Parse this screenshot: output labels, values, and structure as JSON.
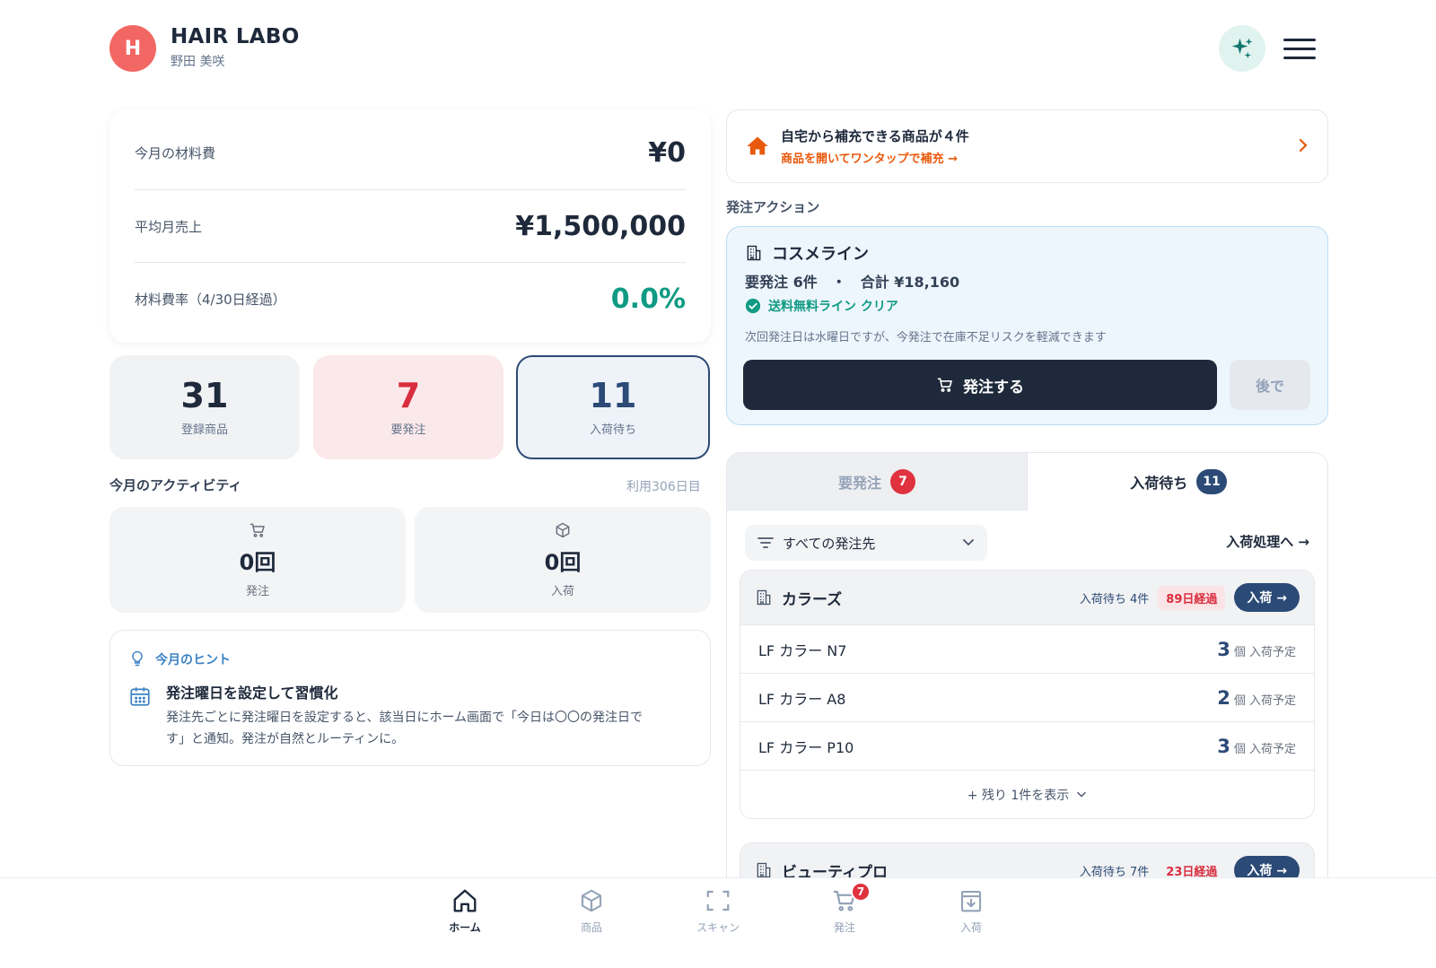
{
  "header": {
    "avatar_initial": "H",
    "brand": "HAIR LABO",
    "user_name": "野田 美咲",
    "ai_icon": "sparkles-icon",
    "menu_icon": "hamburger-menu-icon"
  },
  "metrics": [
    {
      "label": "今月の材料費",
      "value": "¥0"
    },
    {
      "label": "平均月売上",
      "value": "¥1,500,000"
    },
    {
      "label": "材料費率（4/30日経過）",
      "value": "0.0%"
    }
  ],
  "stats": {
    "registered": {
      "value": "31",
      "label": "登録商品"
    },
    "need_order": {
      "value": "7",
      "label": "要発注"
    },
    "awaiting": {
      "value": "11",
      "label": "入荷待ち"
    }
  },
  "activity": {
    "title": "今月のアクティビティ",
    "usage_days": "利用306日目",
    "orders": {
      "value": "0回",
      "label": "発注"
    },
    "arrivals": {
      "value": "0回",
      "label": "入荷"
    }
  },
  "tip": {
    "heading": "今月のヒント",
    "title": "発注曜日を設定して習慣化",
    "body_line1": "発注先ごとに発注曜日を設定すると、該当日にホーム画面で「今日は〇〇の発注日で",
    "body_line2": "す」と通知。発注が自然とルーティンに。"
  },
  "banner": {
    "title": "自宅から補充できる商品が４件",
    "subtitle": "商品を開いてワンタップで補充 →"
  },
  "order_action": {
    "section_label": "発注アクション",
    "supplier": "コスメライン",
    "summary": "要発注 6件　・　合計 ¥18,160",
    "free_shipping": "送料無料ライン クリア",
    "note": "次回発注日は水曜日ですが、今発注で在庫不足リスクを軽減できます",
    "order_button": "発注する",
    "later_button": "後で"
  },
  "tabs": [
    {
      "label": "要発注",
      "count": "7"
    },
    {
      "label": "入荷待ち",
      "count": "11"
    }
  ],
  "filter": {
    "label": "すべての発注先",
    "process_link": "入荷処理へ →"
  },
  "suppliers": [
    {
      "name": "カラーズ",
      "waiting": "入荷待ち 4件",
      "elapsed": "89日経過",
      "button": "入荷 →",
      "items": [
        {
          "name": "LF カラー N7",
          "qty": "3",
          "unit": "個 入荷予定"
        },
        {
          "name": "LF カラー A8",
          "qty": "2",
          "unit": "個 入荷予定"
        },
        {
          "name": "LF カラー P10",
          "qty": "3",
          "unit": "個 入荷予定"
        }
      ],
      "more": "+ 残り 1件を表示"
    },
    {
      "name": "ビューティプロ",
      "waiting": "入荷待ち 7件",
      "elapsed": "23日経過",
      "button": "入荷 →"
    }
  ],
  "bottom_nav": [
    {
      "label": "ホーム",
      "icon": "home-icon",
      "active": true
    },
    {
      "label": "商品",
      "icon": "box-icon"
    },
    {
      "label": "スキャン",
      "icon": "scan-icon"
    },
    {
      "label": "発注",
      "icon": "cart-icon",
      "badge": "7"
    },
    {
      "label": "入荷",
      "icon": "inbox-download-icon"
    }
  ],
  "colors": {
    "avatar": "#f26763",
    "navy": "#2c4a76",
    "danger": "#e0323f",
    "success": "#0f9a83",
    "accent_orange": "#e8590c"
  }
}
